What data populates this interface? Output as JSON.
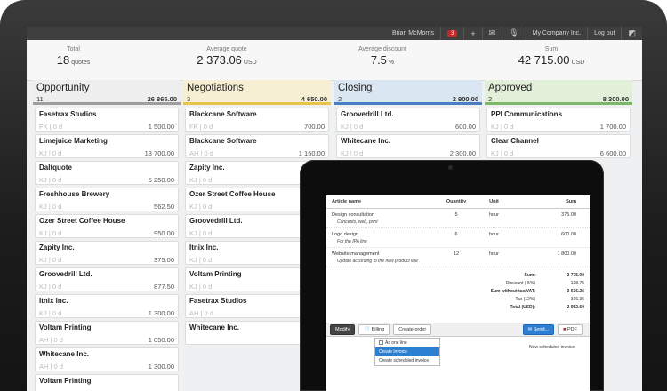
{
  "topbar": {
    "user": "Brian McMorris",
    "notifications": "3",
    "icons": [
      "plus-icon",
      "mail-icon",
      "microphone-icon",
      "settings-icon"
    ],
    "company": "My Company Inc.",
    "logout": "Log out"
  },
  "stats": [
    {
      "label": "Total",
      "value": "18",
      "unit": "quotes"
    },
    {
      "label": "Average quote",
      "value": "2 373.06",
      "unit": "USD"
    },
    {
      "label": "Average discount",
      "value": "7.5",
      "unit": "%"
    },
    {
      "label": "Sum",
      "value": "42 715.00",
      "unit": "USD"
    }
  ],
  "columns": [
    {
      "title": "Opportunity",
      "count": "11",
      "sum": "26 865.00",
      "color": "#9e9e9e",
      "bg": "#eeeeee",
      "cards": [
        {
          "name": "Fasetrax Studios",
          "meta": "FK | 0 d",
          "amount": "1 500.00"
        },
        {
          "name": "Limejuice Marketing",
          "meta": "KJ | 0 d",
          "amount": "13 700.00"
        },
        {
          "name": "Daltquote",
          "meta": "KJ | 0 d",
          "amount": "5 250.00"
        },
        {
          "name": "Freshhouse Brewery",
          "meta": "KJ | 0 d",
          "amount": "562.50"
        },
        {
          "name": "Ozer Street Coffee House",
          "meta": "KJ | 0 d",
          "amount": "950.00"
        },
        {
          "name": "Zapity Inc.",
          "meta": "KJ | 0 d",
          "amount": "375.00"
        },
        {
          "name": "Groovedrill Ltd.",
          "meta": "KJ | 0 d",
          "amount": "877.50"
        },
        {
          "name": "Itnix Inc.",
          "meta": "KJ | 0 d",
          "amount": "1 300.00"
        },
        {
          "name": "Voltam Printing",
          "meta": "AH | 0 d",
          "amount": "1 050.00"
        },
        {
          "name": "Whitecane Inc.",
          "meta": "AH | 0 d",
          "amount": "1 300.00"
        },
        {
          "name": "Voltam Printing",
          "meta": "",
          "amount": ""
        }
      ]
    },
    {
      "title": "Negotiations",
      "count": "3",
      "sum": "4 650.00",
      "color": "#e7c34a",
      "bg": "#f6efd3",
      "cards": [
        {
          "name": "Blackcane Software",
          "meta": "FK | 0 d",
          "amount": "700.00"
        },
        {
          "name": "Blackcane Software",
          "meta": "AH | 0 d",
          "amount": "1 150.00"
        },
        {
          "name": "Zapity Inc.",
          "meta": "KJ | 0 d",
          "amount": ""
        },
        {
          "name": "Ozer Street Coffee House",
          "meta": "KJ | 0 d",
          "amount": ""
        },
        {
          "name": "Groovedrill Ltd.",
          "meta": "KJ | 0 d",
          "amount": ""
        },
        {
          "name": "Itnix Inc.",
          "meta": "KJ | 0 d",
          "amount": ""
        },
        {
          "name": "Voltam Printing",
          "meta": "KJ | 0 d",
          "amount": ""
        },
        {
          "name": "Fasetrax Studios",
          "meta": "AH | 0 d",
          "amount": ""
        },
        {
          "name": "Whitecane Inc.",
          "meta": "",
          "amount": ""
        }
      ]
    },
    {
      "title": "Closing",
      "count": "2",
      "sum": "2 900.00",
      "color": "#4a7fc1",
      "bg": "#dbe6f3",
      "cards": [
        {
          "name": "Groovedrill Ltd.",
          "meta": "KJ | 0 d",
          "amount": "600.00"
        },
        {
          "name": "Whitecane Inc.",
          "meta": "KJ | 0 d",
          "amount": "2 300.00"
        }
      ]
    },
    {
      "title": "Approved",
      "count": "2",
      "sum": "8 300.00",
      "color": "#7bb86a",
      "bg": "#e2f0da",
      "cards": [
        {
          "name": "PPI Communications",
          "meta": "KJ | 0 d",
          "amount": "1 700.00"
        },
        {
          "name": "Clear Channel",
          "meta": "KJ | 0 d",
          "amount": "6 600.00"
        }
      ]
    }
  ],
  "invoice": {
    "headers": [
      "Article name",
      "Quantity",
      "Unit",
      "Sum"
    ],
    "rows": [
      {
        "name": "Design consultation",
        "desc": "Concepts, web, print",
        "qty": "5",
        "unit": "hour",
        "sum": "375.00"
      },
      {
        "name": "Logo design",
        "desc": "For the IPA line",
        "qty": "6",
        "unit": "hour",
        "sum": "600.00"
      },
      {
        "name": "Website management",
        "desc": "Update according to the new product line",
        "qty": "12",
        "unit": "hour",
        "sum": "1 800.00"
      }
    ],
    "totals": [
      {
        "label": "Sum:",
        "value": "2 775.00",
        "bold": true
      },
      {
        "label": "Discount (-5%)",
        "value": "138.75",
        "bold": false
      },
      {
        "label": "Sum without tax/VAT:",
        "value": "2 636.25",
        "bold": true
      },
      {
        "label": "Tax (12%)",
        "value": "316.35",
        "bold": false
      },
      {
        "label": "Total (USD):",
        "value": "2 952.60",
        "bold": true
      }
    ],
    "actions": {
      "modify": "Modify",
      "billing": "Billing",
      "create_order": "Create order",
      "send": "Send...",
      "pdf": "PDF"
    },
    "dropdown": {
      "as_one_line": "As one line",
      "create_invoice": "Create invoice",
      "create_scheduled": "Create scheduled invoice"
    },
    "new_scheduled": "New scheduled invoice"
  }
}
